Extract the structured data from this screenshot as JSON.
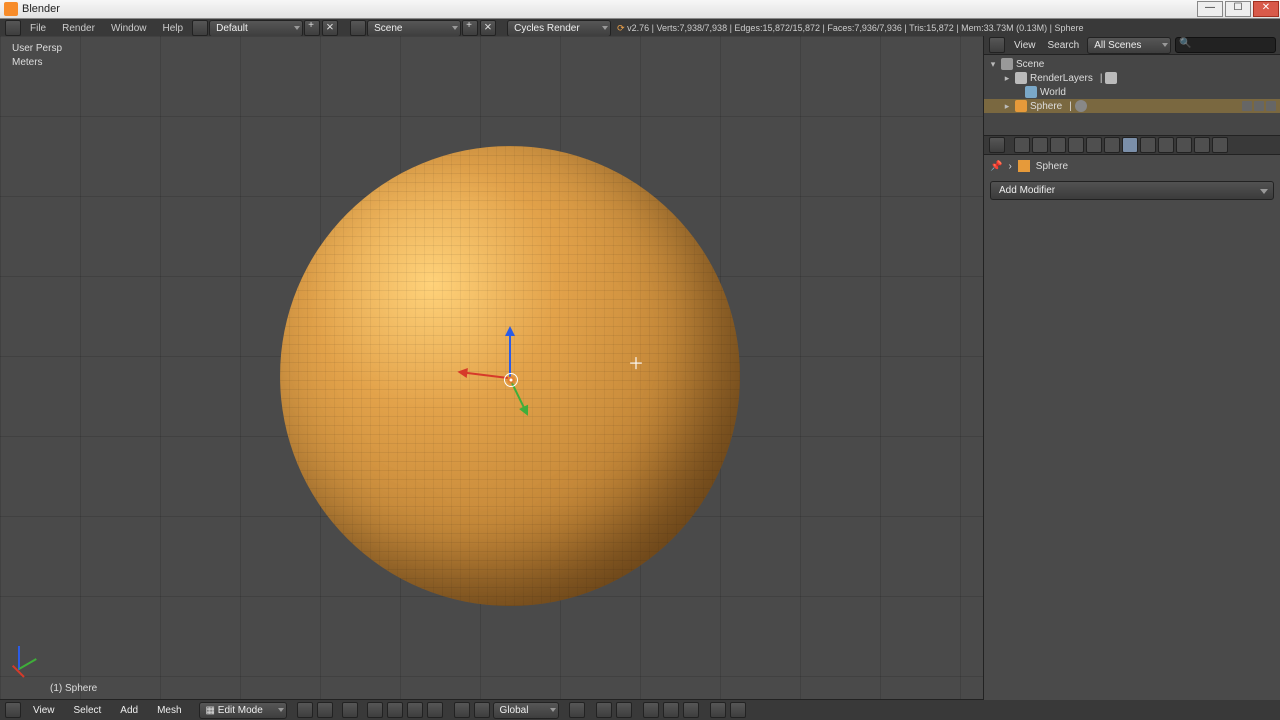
{
  "window": {
    "title": "Blender"
  },
  "top_menu": {
    "file": "File",
    "render": "Render",
    "window": "Window",
    "help": "Help"
  },
  "layout_dropdown": "Default",
  "scene_dropdown": "Scene",
  "engine_dropdown": "Cycles Render",
  "stats": {
    "version": "v2.76",
    "verts": "Verts:7,938/7,938",
    "edges": "Edges:15,872/15,872",
    "faces": "Faces:7,936/7,936",
    "tris": "Tris:15,872",
    "mem": "Mem:33.73M (0.13M)",
    "obj": "Sphere"
  },
  "viewport_overlay": {
    "persp": "User Persp",
    "units": "Meters",
    "obj_label": "(1) Sphere"
  },
  "outliner": {
    "view_label": "View",
    "search_label": "Search",
    "filter": "All Scenes",
    "scene": "Scene",
    "renderlayers": "RenderLayers",
    "world": "World",
    "object": "Sphere"
  },
  "properties": {
    "crumb_obj": "Sphere",
    "add_modifier": "Add Modifier"
  },
  "view_header": {
    "view": "View",
    "select": "Select",
    "add": "Add",
    "mesh": "Mesh",
    "mode": "Edit Mode",
    "orientation": "Global"
  },
  "colors": {
    "accent": "#e69a3a"
  }
}
